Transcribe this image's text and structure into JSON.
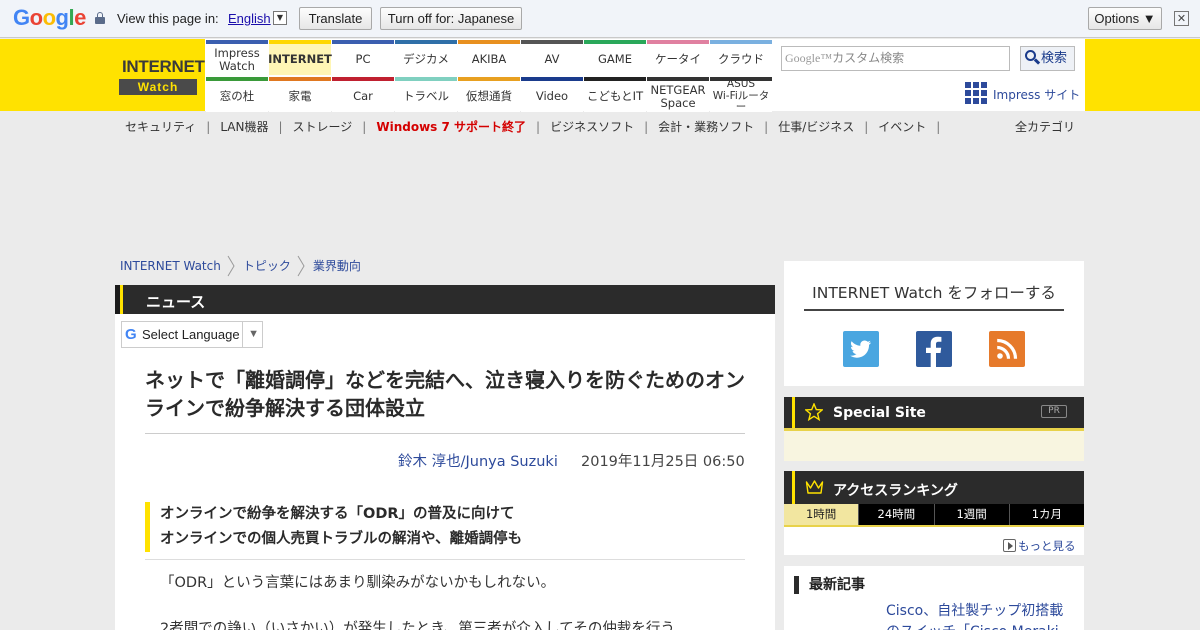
{
  "translate_bar": {
    "logo": [
      "G",
      "o",
      "o",
      "g",
      "l",
      "e"
    ],
    "view_text": "View this page in:",
    "language": "English",
    "translate_label": "Translate",
    "turn_off_label": "Turn off for: Japanese",
    "options_label": "Options ▼",
    "close_label": "✕"
  },
  "header": {
    "logo_top": "INTERNET",
    "logo_bottom": "Watch",
    "nav_top": [
      {
        "label": "Impress\nWatch",
        "color": "#3b5fb0"
      },
      {
        "label": "INTERNET",
        "color": "#ffd800",
        "active": true
      },
      {
        "label": "PC",
        "color": "#3b5fb0"
      },
      {
        "label": "デジカメ",
        "color": "#2f6fa8"
      },
      {
        "label": "AKIBA",
        "color": "#e89020"
      },
      {
        "label": "AV",
        "color": "#555555"
      },
      {
        "label": "GAME",
        "color": "#2aa85a"
      },
      {
        "label": "ケータイ",
        "color": "#e080a0"
      },
      {
        "label": "クラウド",
        "color": "#7ab0e0"
      }
    ],
    "nav_bottom": [
      {
        "label": "窓の杜",
        "color": "#3a9a3a"
      },
      {
        "label": "家電",
        "color": "#e07820"
      },
      {
        "label": "Car",
        "color": "#c02030"
      },
      {
        "label": "トラベル",
        "color": "#80d0c0"
      },
      {
        "label": "仮想通貨",
        "color": "#e8a020"
      },
      {
        "label": "Video",
        "color": "#1a3b8c"
      },
      {
        "label": "こどもとIT",
        "color": "#222222"
      },
      {
        "label": "NETGEAR\nSpace",
        "color": "#333333"
      },
      {
        "label": "ASUS\nWi-Fiルーター",
        "color": "#333333"
      }
    ],
    "search_placeholder_brand": "Google™",
    "search_placeholder": "カスタム検索",
    "search_button": "検索",
    "impress_link": "Impress サイト"
  },
  "subnav": {
    "items": [
      {
        "label": "セキュリティ"
      },
      {
        "label": "LAN機器"
      },
      {
        "label": "ストレージ"
      },
      {
        "label": "Windows 7 サポート終了",
        "highlight": true
      },
      {
        "label": "ビジネスソフト"
      },
      {
        "label": "会計・業務ソフト"
      },
      {
        "label": "仕事/ビジネス"
      },
      {
        "label": "イベント"
      }
    ],
    "all_categories": "全カテゴリ"
  },
  "breadcrumb": [
    "INTERNET Watch",
    "トピック",
    "業界動向"
  ],
  "article": {
    "section": "ニュース",
    "lang_select": "Select Language",
    "headline": "ネットで「離婚調停」などを完結へ、泣き寝入りを防ぐためのオンラインで紛争解決する団体設立",
    "author": "鈴木 淳也/Junya Suzuki",
    "date": "2019年11月25日 06:50",
    "lead_1": "オンラインで紛争を解決する「ODR」の普及に向けて",
    "lead_2": "オンラインでの個人売買トラブルの解消や、離婚調停も",
    "para_1": "「ODR」という言葉にはあまり馴染みがないかもしれない。",
    "para_2": "2者間での諍い（いさかい）が発生したとき、第三者が介入してその仲裁を行う"
  },
  "sidebar": {
    "follow_title": "INTERNET Watch をフォローする",
    "special_site": "Special Site",
    "pr": "PR",
    "ranking_title": "アクセスランキング",
    "ranking_tabs": [
      "1時間",
      "24時間",
      "1週間",
      "1カ月"
    ],
    "more": "もっと見る",
    "latest_title": "最新記事",
    "latest_item": "Cisco、自社製チップ初搭載のスイッチ「Cisco Meraki"
  },
  "colors": {
    "brand_yellow": "#ffe200",
    "link_blue": "#2d4a9b",
    "dark_bar": "#2b2b2b",
    "twitter": "#4aa6e0",
    "facebook": "#2f5a9c",
    "rss": "#e67a2b"
  }
}
